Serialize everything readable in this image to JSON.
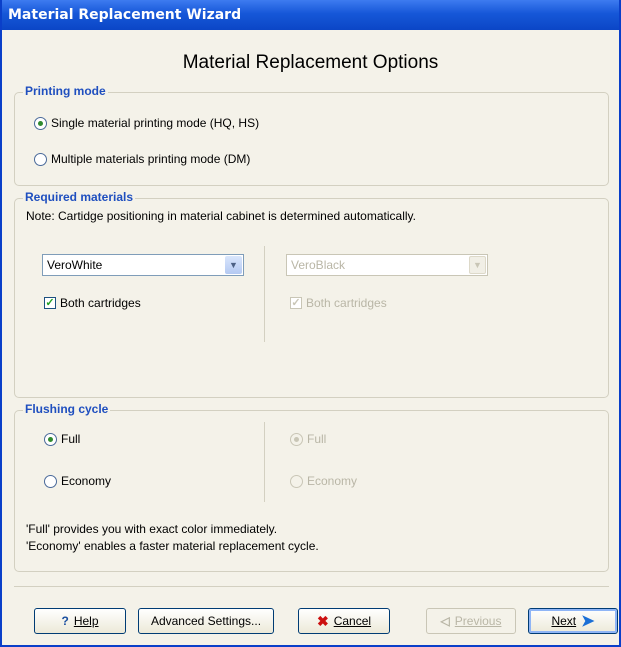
{
  "window": {
    "title": "Material Replacement Wizard"
  },
  "page_title": "Material Replacement Options",
  "printing_mode": {
    "legend": "Printing mode",
    "options": [
      {
        "label": "Single material printing mode (HQ, HS)",
        "selected": true
      },
      {
        "label": "Multiple materials printing mode (DM)",
        "selected": false
      }
    ]
  },
  "required_materials": {
    "legend": "Required materials",
    "note": "Note: Cartidge positioning in material cabinet is determined automatically.",
    "left": {
      "material": "VeroWhite",
      "both_cartridges": "Both cartridges",
      "checked": true,
      "enabled": true
    },
    "right": {
      "material": "VeroBlack",
      "both_cartridges": "Both cartridges",
      "checked": true,
      "enabled": false
    }
  },
  "flushing_cycle": {
    "legend": "Flushing cycle",
    "left": {
      "full": "Full",
      "economy": "Economy",
      "selected": "Full"
    },
    "right": {
      "full": "Full",
      "economy": "Economy",
      "selected": "Full",
      "enabled": false
    },
    "info_line1": "'Full' provides you with exact color immediately.",
    "info_line2": "'Economy' enables a faster material replacement cycle."
  },
  "buttons": {
    "help": "Help",
    "advanced": "Advanced Settings...",
    "cancel": "Cancel",
    "previous": "Previous",
    "next": "Next"
  },
  "icons": {
    "help": "question-mark-icon",
    "cancel": "red-x-icon",
    "previous": "left-arrow-icon",
    "next": "right-arrow-icon"
  },
  "colors": {
    "titlebar": "#1657d8",
    "legend": "#1f4fbf",
    "cancel_x": "#cc1010",
    "next_arrow": "#1a6fd6"
  }
}
